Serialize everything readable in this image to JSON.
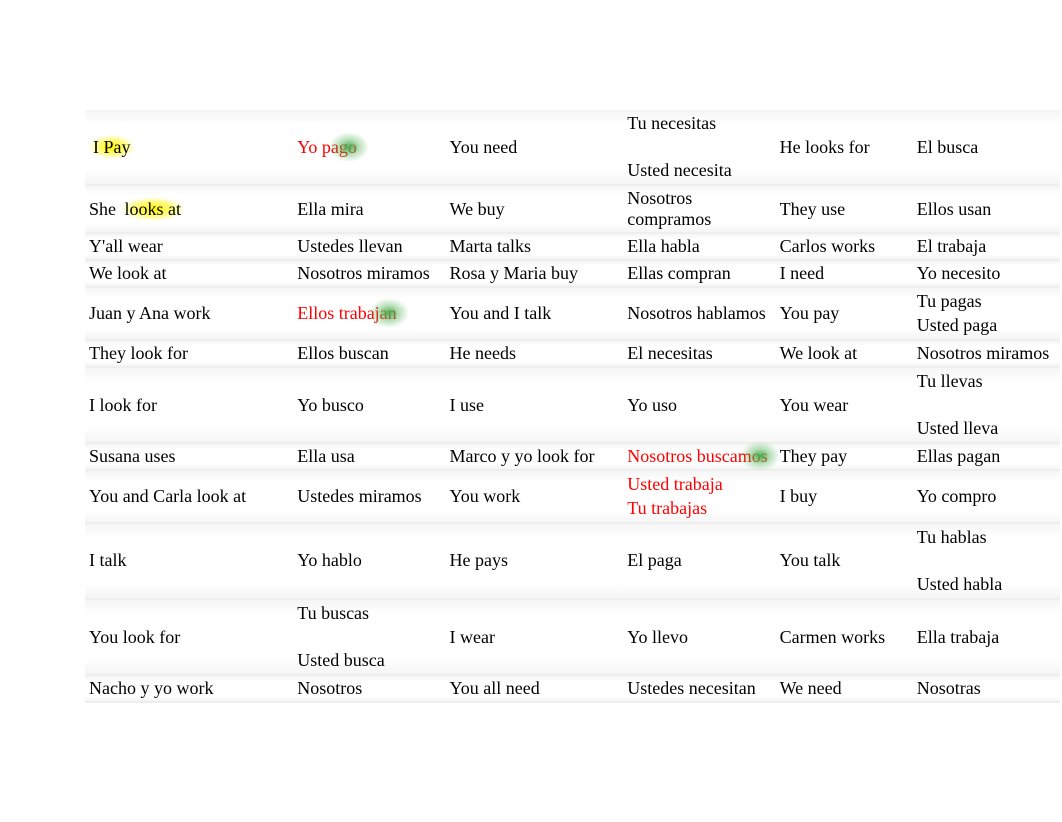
{
  "rows": [
    {
      "c1": {
        "text": "I Pay",
        "hlYellow": true
      },
      "c2": {
        "text": "Yo pago",
        "red": true,
        "hlGreen": true
      },
      "c3": {
        "text": "You need"
      },
      "c4": {
        "text": "Tu necesitas\n\nUsted necesita",
        "multi": true
      },
      "c5": {
        "text": "He looks for"
      },
      "c6": {
        "text": "El busca"
      }
    },
    {
      "c1": {
        "text": "She looks at",
        "hlYellowPartial": "looks at"
      },
      "c2": {
        "text": "Ella mira"
      },
      "c3": {
        "text": "We buy"
      },
      "c4": {
        "text": "Nosotros compramos"
      },
      "c5": {
        "text": "They use"
      },
      "c6": {
        "text": "Ellos usan"
      }
    },
    {
      "c1": {
        "text": "Y'all wear"
      },
      "c2": {
        "text": "Ustedes llevan"
      },
      "c3": {
        "text": "Marta talks"
      },
      "c4": {
        "text": "Ella habla"
      },
      "c5": {
        "text": "Carlos works"
      },
      "c6": {
        "text": "El trabaja"
      }
    },
    {
      "c1": {
        "text": "We look at"
      },
      "c2": {
        "text": "Nosotros miramos"
      },
      "c3": {
        "text": "Rosa y Maria buy"
      },
      "c4": {
        "text": "Ellas compran"
      },
      "c5": {
        "text": "I need"
      },
      "c6": {
        "text": "Yo necesito"
      }
    },
    {
      "c1": {
        "text": "Juan y Ana work"
      },
      "c2": {
        "text": "Ellos trabajan",
        "red": true,
        "hlGreen": true
      },
      "c3": {
        "text": "You and I talk"
      },
      "c4": {
        "text": "Nosotros hablamos"
      },
      "c5": {
        "text": "You pay"
      },
      "c6": {
        "text": "Tu pagas\nUsted paga",
        "multi": true
      }
    },
    {
      "c1": {
        "text": "They look for"
      },
      "c2": {
        "text": "Ellos buscan"
      },
      "c3": {
        "text": "He needs"
      },
      "c4": {
        "text": "El necesitas"
      },
      "c5": {
        "text": "We look at"
      },
      "c6": {
        "text": "Nosotros miramos"
      }
    },
    {
      "c1": {
        "text": "I look for"
      },
      "c2": {
        "text": "Yo busco"
      },
      "c3": {
        "text": "I use"
      },
      "c4": {
        "text": "Yo uso"
      },
      "c5": {
        "text": "You wear"
      },
      "c6": {
        "text": "Tu llevas\n\nUsted lleva",
        "multi": true
      }
    },
    {
      "c1": {
        "text": "Susana uses"
      },
      "c2": {
        "text": "Ella usa"
      },
      "c3": {
        "text": "Marco y yo look for"
      },
      "c4": {
        "text": "Nosotros buscamos",
        "red": true,
        "hlGreen": true
      },
      "c5": {
        "text": "They pay"
      },
      "c6": {
        "text": "Ellas pagan"
      }
    },
    {
      "c1": {
        "text": "You and Carla look at"
      },
      "c2": {
        "text": "Ustedes miramos"
      },
      "c3": {
        "text": "You work"
      },
      "c4": {
        "text": "Usted trabaja\nTu trabajas",
        "red": true,
        "multi": true
      },
      "c5": {
        "text": "I buy"
      },
      "c6": {
        "text": "Yo compro"
      }
    },
    {
      "c1": {
        "text": "I talk"
      },
      "c2": {
        "text": "Yo hablo"
      },
      "c3": {
        "text": "He pays"
      },
      "c4": {
        "text": "El paga"
      },
      "c5": {
        "text": "You talk"
      },
      "c6": {
        "text": "Tu hablas\n\nUsted habla",
        "multi": true
      }
    },
    {
      "c1": {
        "text": "You look for"
      },
      "c2": {
        "text": "Tu buscas\n\nUsted busca",
        "multi": true
      },
      "c3": {
        "text": "I wear"
      },
      "c4": {
        "text": "Yo llevo"
      },
      "c5": {
        "text": "Carmen works"
      },
      "c6": {
        "text": "Ella trabaja"
      }
    },
    {
      "c1": {
        "text": "Nacho y yo work"
      },
      "c2": {
        "text": "Nosotros"
      },
      "c3": {
        "text": "You all need"
      },
      "c4": {
        "text": "Ustedes necesitan"
      },
      "c5": {
        "text": "We need"
      },
      "c6": {
        "text": "Nosotras"
      }
    }
  ]
}
